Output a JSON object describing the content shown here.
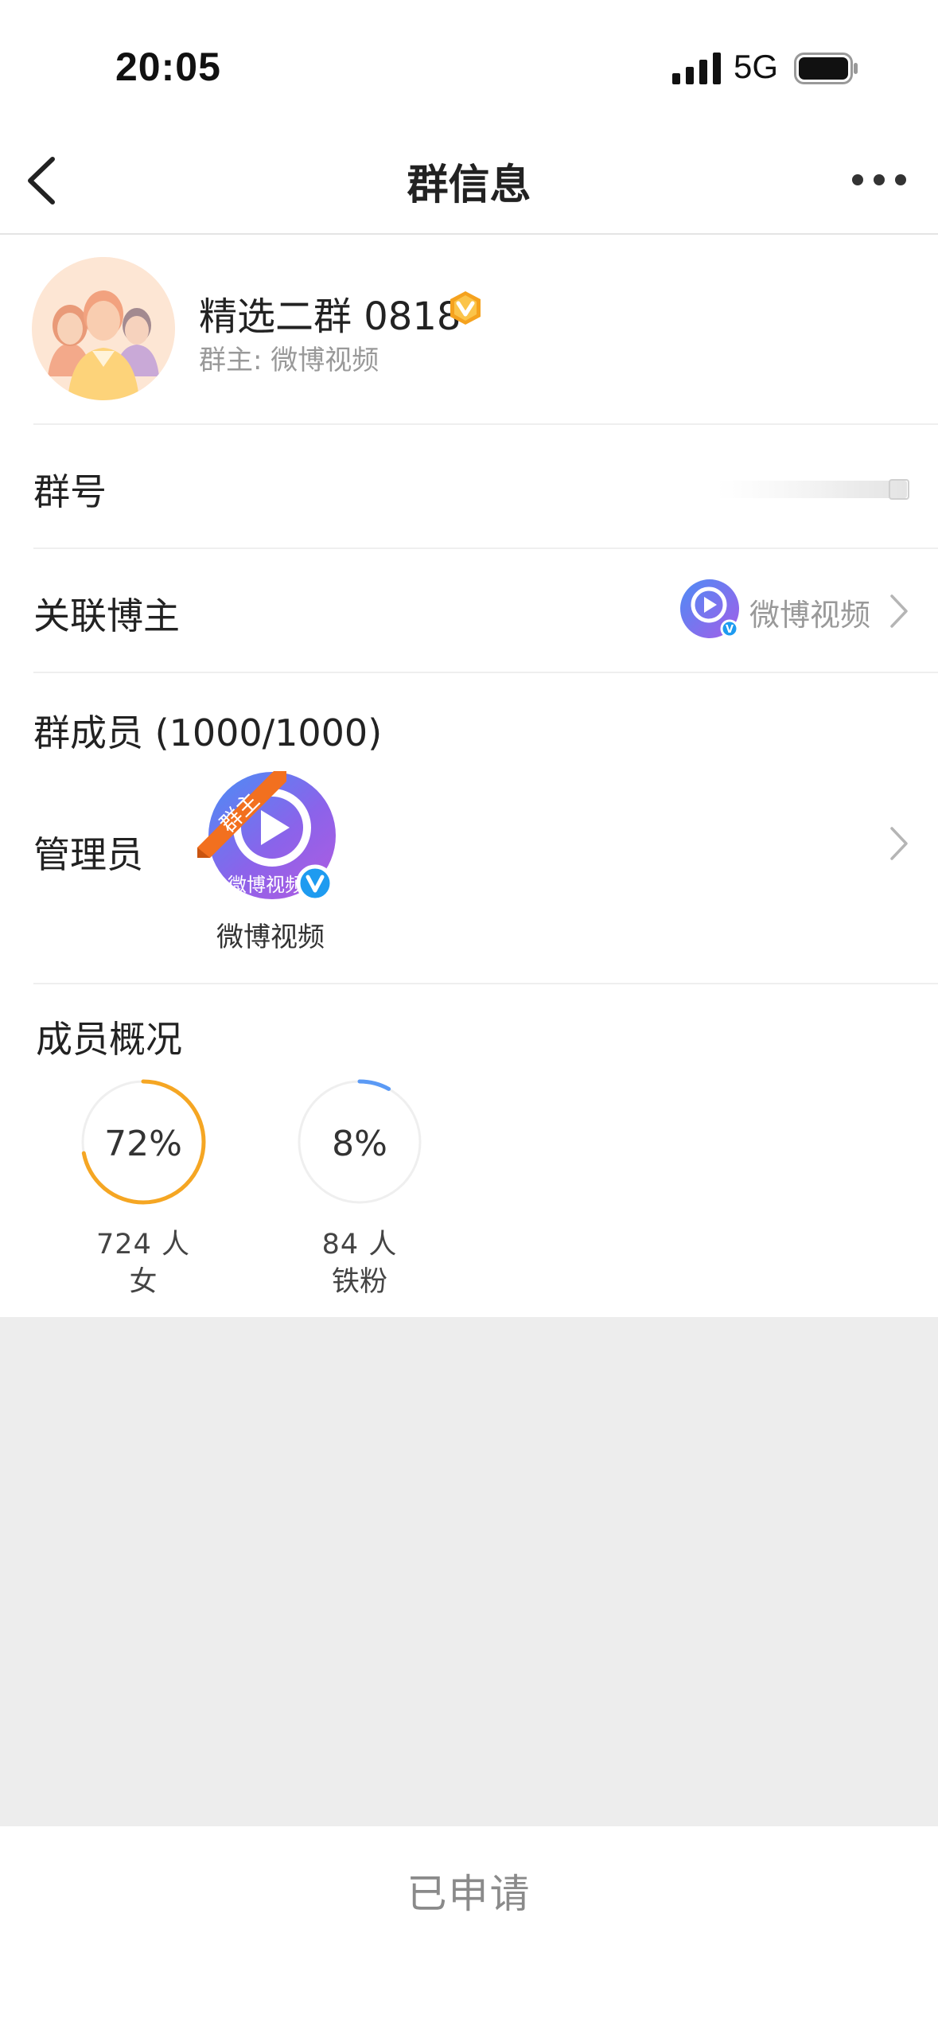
{
  "status_bar": {
    "time": "20:05",
    "network": "5G",
    "icons": [
      "signal-icon",
      "battery-icon"
    ]
  },
  "nav": {
    "title": "群信息",
    "back_icon": "chevron-left-icon",
    "more_icon": "more-dots-icon"
  },
  "group": {
    "name": "精选二群 0818",
    "owner_line": "群主: 微博视频",
    "badge_icon": "vip-badge-icon",
    "badge_color": "#f5a21e"
  },
  "rows": {
    "group_number": {
      "label": "群号"
    },
    "linked_blogger": {
      "label": "关联博主",
      "name": "微博视频"
    },
    "members": {
      "label": "群成员 (1000/1000)"
    },
    "admins": {
      "label": "管理员",
      "admin_name": "微博视频",
      "owner_tag": "群主",
      "avatar_text": "微博视频"
    }
  },
  "overview": {
    "title": "成员概况",
    "stats": [
      {
        "percent_label": "72%",
        "percent": 72,
        "count": "724 人",
        "category": "女",
        "color": "#f5a623"
      },
      {
        "percent_label": "8%",
        "percent": 8,
        "count": "84 人",
        "category": "铁粉",
        "color": "#5b9af5"
      }
    ]
  },
  "footer": {
    "button_label": "已申请"
  },
  "colors": {
    "accent_orange": "#f5a623",
    "accent_blue": "#5b9af5",
    "ribbon": "#f2701f",
    "verified": "#1e9bf0"
  }
}
